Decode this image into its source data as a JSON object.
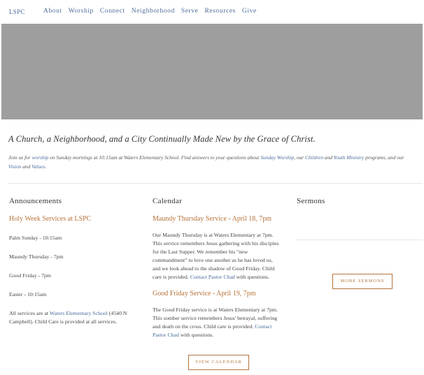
{
  "nav": {
    "logo": "LSPC",
    "items": [
      "About",
      "Worship",
      "Connect",
      "Neighborhood",
      "Serve",
      "Resources",
      "Give"
    ]
  },
  "hero": {
    "tagline": "A Church, a Neighborhood, and a City Continually Made New by the Grace of Christ.",
    "intro": {
      "t1": "Join us for ",
      "l1": "worship",
      "t2": " on Sunday mornings at 10:15am at Waters Elementary School. Find answers to your questions about ",
      "l2": "Sunday Worship",
      "t3": ", our ",
      "l3": "Children",
      "t4": " and ",
      "l4": "Youth Ministry",
      "t5": " programs, and our ",
      "l5": "Vision",
      "t6": " and ",
      "l6": "Values",
      "t7": "."
    }
  },
  "announcements": {
    "heading": "Announcements",
    "post_title": "Holy Week Services at LSPC",
    "lines": [
      "Palm Sunday - 10:15am",
      "Maundy Thursday - 7pm",
      "Good Friday - 7pm",
      "Easter - 10:15am"
    ],
    "footer": {
      "t1": "All services are at ",
      "link": "Waters Elementary School",
      "t2": " (4540 N Campbell). Child Care is provided at all services."
    }
  },
  "calendar": {
    "heading": "Calendar",
    "events": [
      {
        "title": "Maundy Thursday Service -  April 18, 7pm",
        "body": "Our Maundy Thursday is at Waters Elementary at 7pm. This service remembers Jesus gathering with his disciples for the Last Supper. We remember his \"new commandment\" to love one another as he has loved us, and we look ahead to the shadow of Good Friday. Child care is provided. ",
        "link": "Contact Pastor Chad",
        "tail": " with questions."
      },
      {
        "title": "Good Friday Service - April 19, 7pm",
        "body": "The Good Friday service is at Waters Elementary at 7pm. This somber service remembers Jesus' betrayal, suffering and death on the cross. Child care is provided. ",
        "link": "Contact Pastor Chad",
        "tail": " with questions."
      }
    ],
    "button": "VIEW CALENDAR"
  },
  "sermons": {
    "heading": "Sermons",
    "button": "MORE SERMONS"
  }
}
